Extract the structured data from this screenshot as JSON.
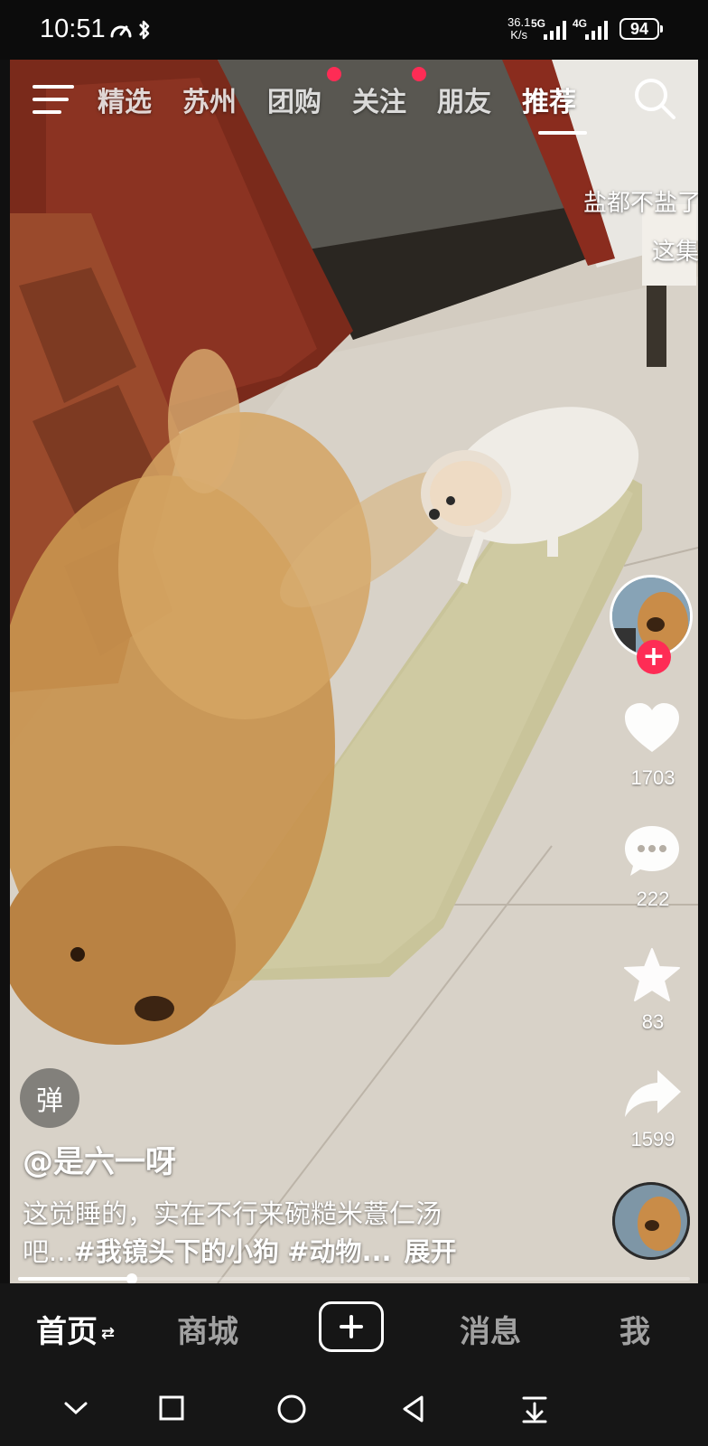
{
  "status_bar": {
    "time": "10:51",
    "net_speed_value": "36.1",
    "net_speed_unit": "K/s",
    "sim1_label": "5G",
    "sim2_label": "4G",
    "battery": "94"
  },
  "top_tabs": [
    {
      "label": "精选",
      "active": false,
      "dot": false
    },
    {
      "label": "苏州",
      "active": false,
      "dot": false
    },
    {
      "label": "团购",
      "active": false,
      "dot": true
    },
    {
      "label": "关注",
      "active": false,
      "dot": true
    },
    {
      "label": "朋友",
      "active": false,
      "dot": false
    },
    {
      "label": "推荐",
      "active": true,
      "dot": false
    }
  ],
  "overlay": {
    "text_line1": "盐都不盐了",
    "text_line2": "这集"
  },
  "actions": {
    "likes": "1703",
    "comments": "222",
    "favorites": "83",
    "shares": "1599"
  },
  "danmu_label": "弹",
  "post": {
    "author": "@是六一呀",
    "desc_line1": "这觉睡的，实在不行来碗糙米薏仁汤",
    "desc_prefix": "吧...",
    "tag1": "#我镜头下的小狗",
    "tag2": "#动物...",
    "expand": "展开"
  },
  "progress": {
    "played_fraction": 0.17
  },
  "bottom_nav": {
    "home": "首页",
    "mall": "商城",
    "messages": "消息",
    "me": "我"
  },
  "colors": {
    "accent": "#fe2c55",
    "nav_bg": "#161616"
  }
}
